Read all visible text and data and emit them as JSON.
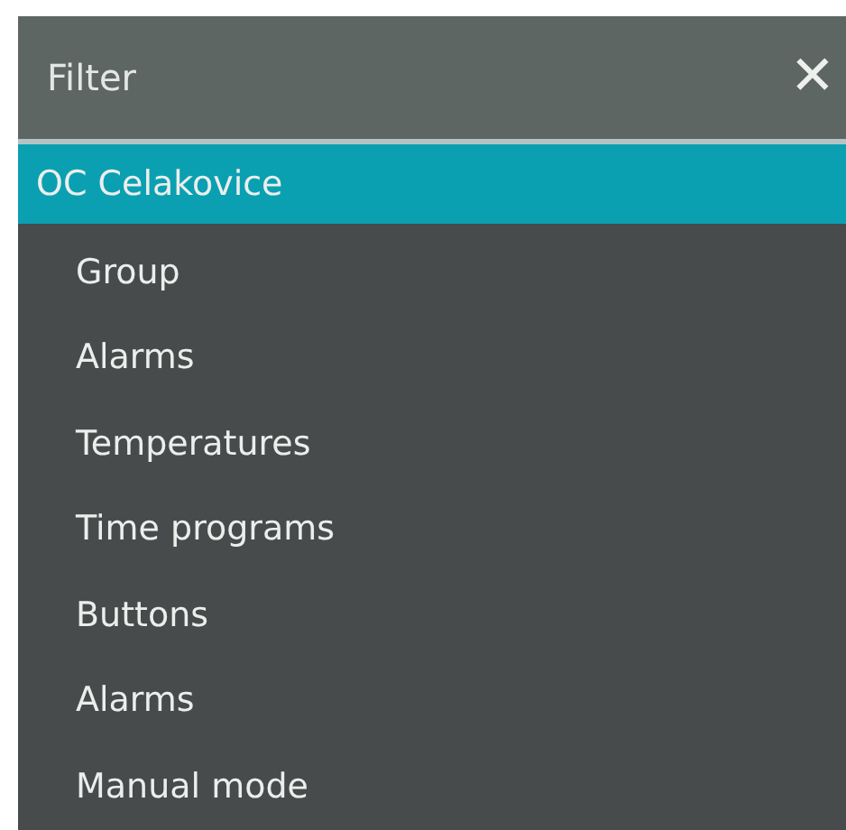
{
  "header": {
    "title": "Filter",
    "close": "✕"
  },
  "tree": [
    {
      "label": "OC Celakovice",
      "selected": true,
      "children": [
        {
          "label": "Group",
          "selected": false
        },
        {
          "label": "Alarms",
          "selected": false
        },
        {
          "label": "Temperatures",
          "selected": false
        },
        {
          "label": "Time programs",
          "selected": false
        },
        {
          "label": "Buttons",
          "selected": false
        },
        {
          "label": "Alarms",
          "selected": false
        },
        {
          "label": "Manual mode",
          "selected": false
        }
      ]
    }
  ]
}
